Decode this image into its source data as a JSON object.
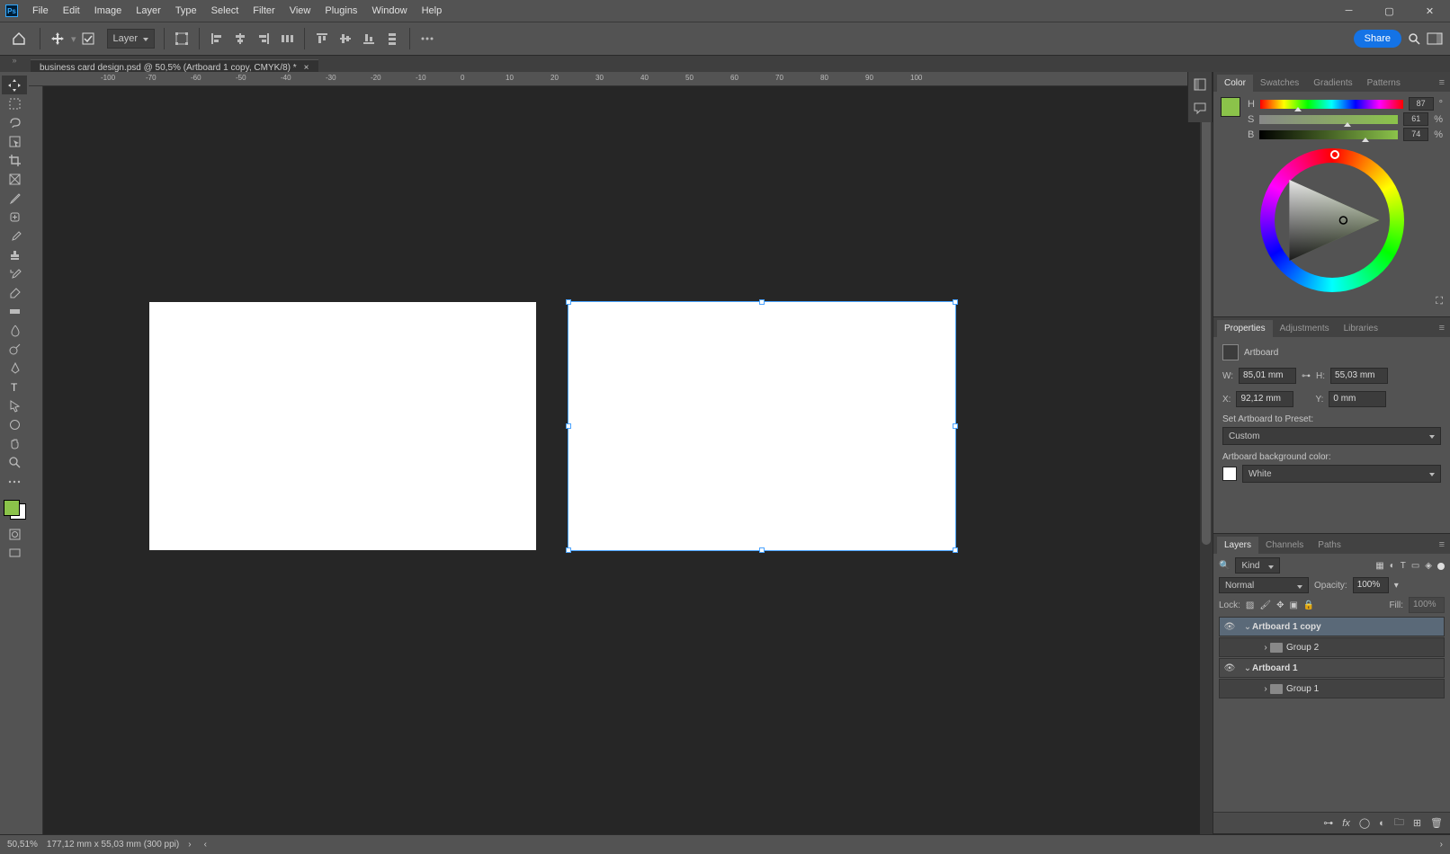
{
  "menu": {
    "items": [
      "File",
      "Edit",
      "Image",
      "Layer",
      "Type",
      "Select",
      "Filter",
      "View",
      "Plugins",
      "Window",
      "Help"
    ]
  },
  "optbar": {
    "mode": "Layer",
    "share": "Share"
  },
  "doc": {
    "title": "business card design.psd @ 50,5% (Artboard 1 copy, CMYK/8) *"
  },
  "ruler_ticks": [
    "-100",
    "-70",
    "-60",
    "-50",
    "-40",
    "-30",
    "-20",
    "-10",
    "0",
    "10",
    "20",
    "30",
    "40",
    "50",
    "60",
    "70",
    "80",
    "90",
    "100"
  ],
  "color": {
    "tabs": [
      "Color",
      "Swatches",
      "Gradients",
      "Patterns"
    ],
    "H": "87",
    "S": "61",
    "B": "74",
    "swatch": "#8bc34a"
  },
  "properties": {
    "tabs": [
      "Properties",
      "Adjustments",
      "Libraries"
    ],
    "type": "Artboard",
    "W": "85,01 mm",
    "H": "55,03 mm",
    "X": "92,12 mm",
    "Y": "0 mm",
    "preset_label": "Set Artboard to Preset:",
    "preset": "Custom",
    "bgcolor_label": "Artboard background color:",
    "bgcolor": "White"
  },
  "layers": {
    "tabs": [
      "Layers",
      "Channels",
      "Paths"
    ],
    "filter": "Kind",
    "blend": "Normal",
    "opacity_label": "Opacity:",
    "opacity": "100%",
    "lock_label": "Lock:",
    "fill_label": "Fill:",
    "fill": "100%",
    "items": [
      {
        "name": "Artboard 1 copy",
        "bold": true,
        "selected": true,
        "open": true,
        "eye": true
      },
      {
        "name": "Group 2",
        "indent": 1,
        "folder": true
      },
      {
        "name": "Artboard 1",
        "bold": true,
        "open": true,
        "eye": true
      },
      {
        "name": "Group 1",
        "indent": 1,
        "folder": true
      }
    ]
  },
  "status": {
    "zoom": "50,51%",
    "info": "177,12 mm x 55,03 mm (300 ppi)"
  },
  "chart_data": null
}
